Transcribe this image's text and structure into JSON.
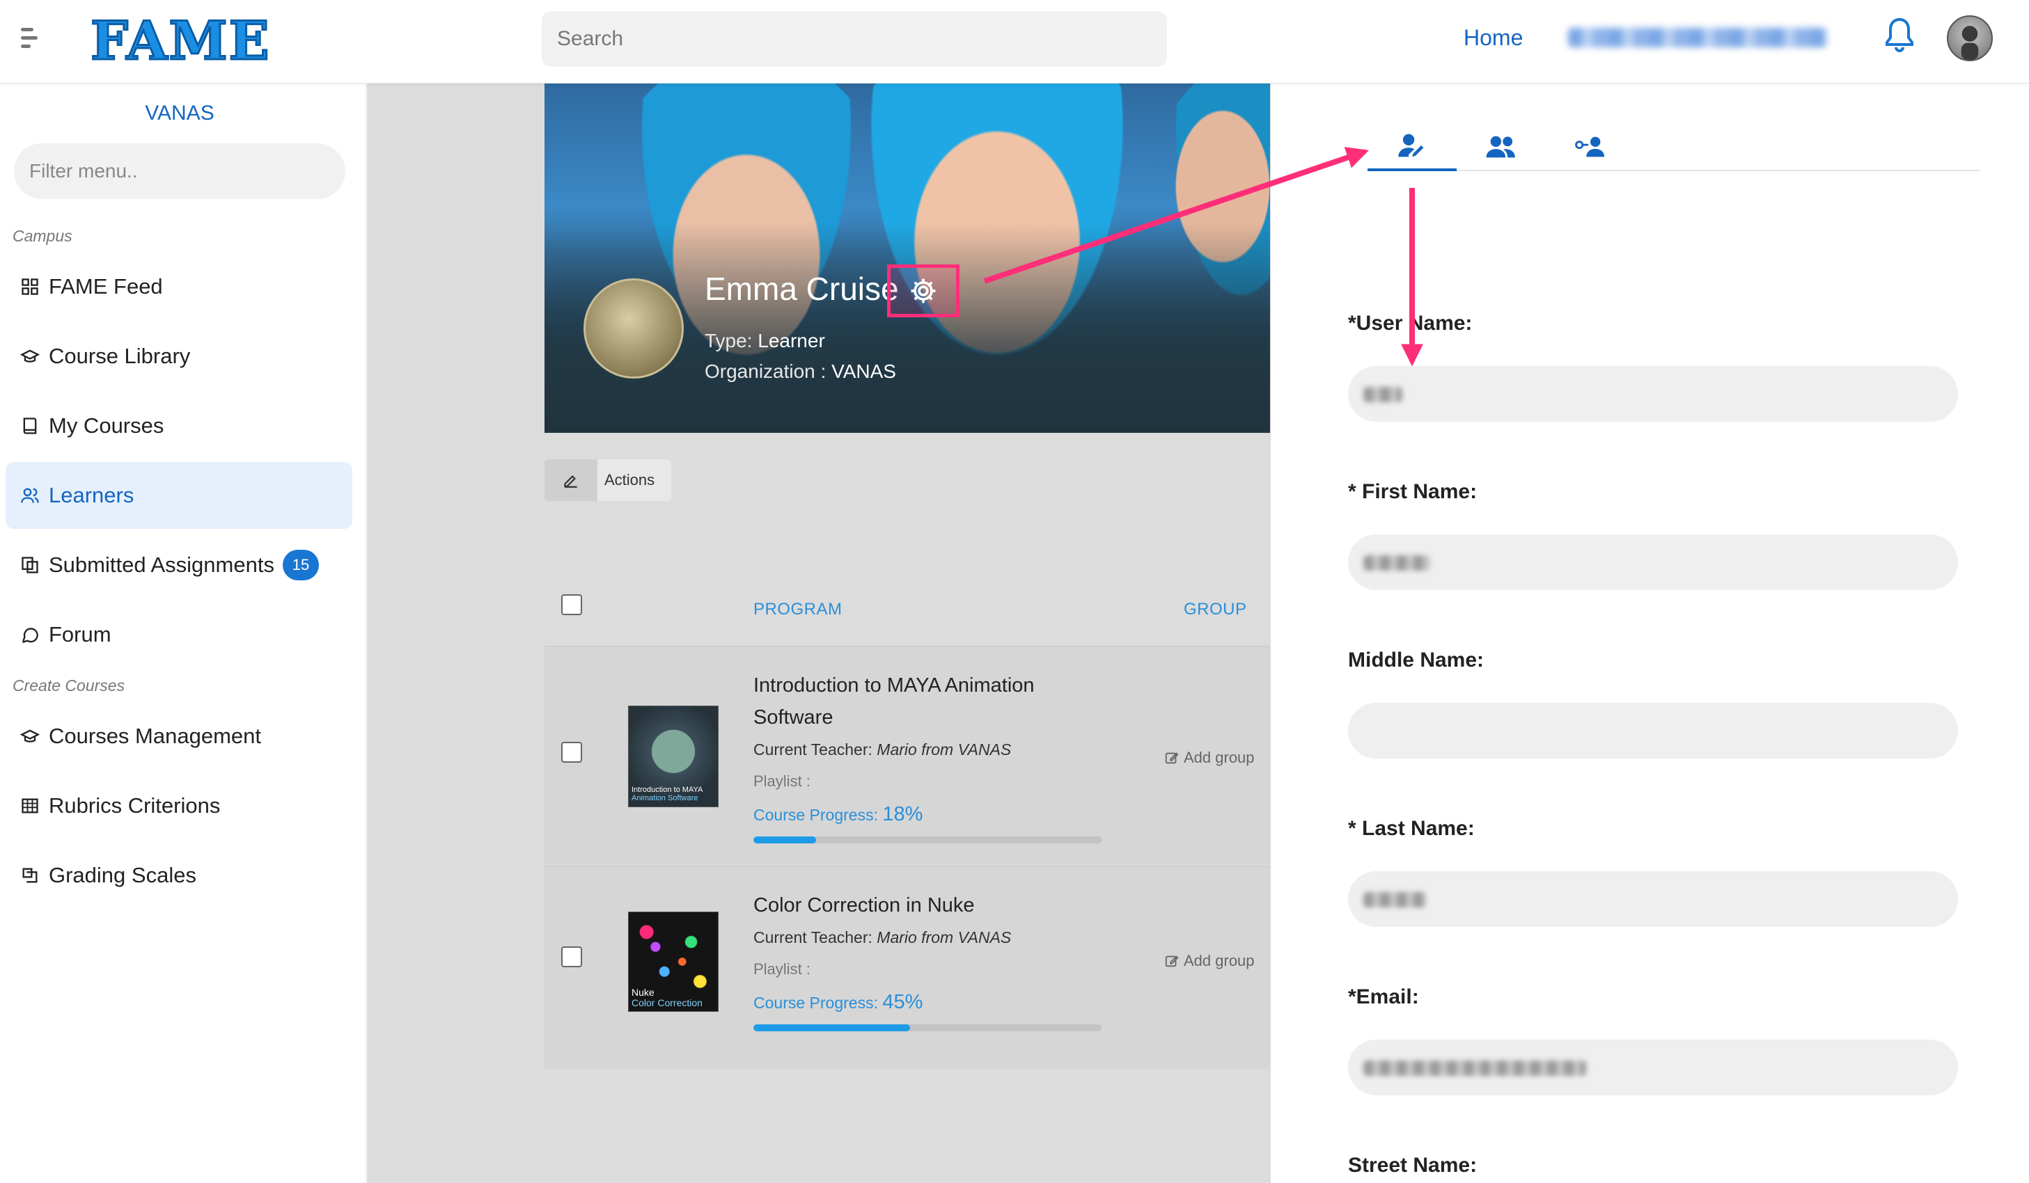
{
  "header": {
    "logo": "FAME",
    "search_placeholder": "Search",
    "home_label": "Home"
  },
  "sidebar": {
    "org_name": "VANAS",
    "filter_placeholder": "Filter menu..",
    "section_campus": "Campus",
    "section_create": "Create Courses",
    "items": [
      {
        "label": "FAME Feed",
        "icon": "grid-icon"
      },
      {
        "label": "Course Library",
        "icon": "graduation-cap-icon"
      },
      {
        "label": "My Courses",
        "icon": "book-icon"
      },
      {
        "label": "Learners",
        "icon": "users-icon",
        "active": true
      },
      {
        "label": "Submitted Assignments",
        "icon": "assignment-icon",
        "badge": "15"
      },
      {
        "label": "Forum",
        "icon": "chat-bubble-icon"
      },
      {
        "label": "Courses Management",
        "icon": "graduation-cap-icon"
      },
      {
        "label": "Rubrics Criterions",
        "icon": "table-icon"
      },
      {
        "label": "Grading Scales",
        "icon": "scale-icon"
      }
    ]
  },
  "profile": {
    "name": "Emma Cruise",
    "type_label": "Type:",
    "type_value": "Learner",
    "org_label": "Organization :",
    "org_value": "VANAS"
  },
  "toolbar": {
    "actions_label": "Actions"
  },
  "table": {
    "col_program": "PROGRAM",
    "col_group": "GROUP",
    "rows": [
      {
        "title": "Introduction to MAYA Animation Software",
        "teacher_label": "Current Teacher:",
        "teacher": "Mario from VANAS",
        "playlist_label": "Playlist :",
        "progress_label": "Course Progress:",
        "progress_text": "18%",
        "progress": 18,
        "add_group": "Add group",
        "thumb_line1": "Introduction to MAYA",
        "thumb_line2": "Animation Software"
      },
      {
        "title": "Color Correction in Nuke",
        "teacher_label": "Current Teacher:",
        "teacher": "Mario from VANAS",
        "playlist_label": "Playlist :",
        "progress_label": "Course Progress:",
        "progress_text": "45%",
        "progress": 45,
        "add_group": "Add group",
        "thumb_line1": "Nuke",
        "thumb_line2": "Color Correction"
      }
    ]
  },
  "form": {
    "username_label": "*User Name:",
    "first_name_label": "* First Name:",
    "middle_name_label": "Middle Name:",
    "last_name_label": "* Last Name:",
    "email_label": "*Email:",
    "street_label": "Street Name:"
  },
  "colors": {
    "accent": "#1565c0",
    "annotation": "#ff2e78",
    "progress": "#1e9be6"
  }
}
